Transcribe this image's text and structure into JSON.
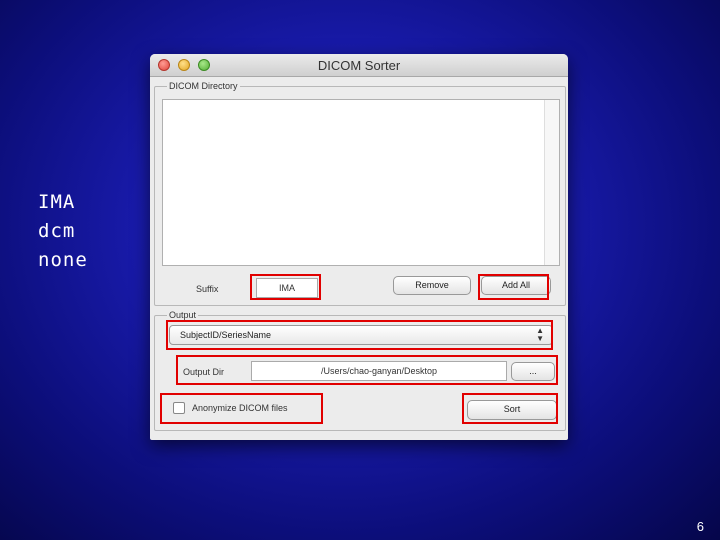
{
  "slide": {
    "side_lines": [
      "IMA",
      "dcm",
      "none"
    ],
    "page_number": "6",
    "highlight_color": "#e10000"
  },
  "window": {
    "title": "DICOM Sorter",
    "traffic_lights": [
      "close-button",
      "minimize-button",
      "zoom-button"
    ]
  },
  "dicom_directory": {
    "group_label": "DICOM Directory",
    "list_items": [],
    "suffix_label": "Suffix",
    "suffix_value": "IMA",
    "remove_label": "Remove",
    "add_all_label": "Add All"
  },
  "output": {
    "group_label": "Output",
    "naming_selected": "SubjectID/SeriesName",
    "output_dir_label": "Output Dir",
    "output_dir_value": "/Users/chao-ganyan/Desktop",
    "browse_label": "...",
    "anonymize_label": "Anonymize DICOM files",
    "anonymize_checked": false,
    "sort_label": "Sort"
  }
}
